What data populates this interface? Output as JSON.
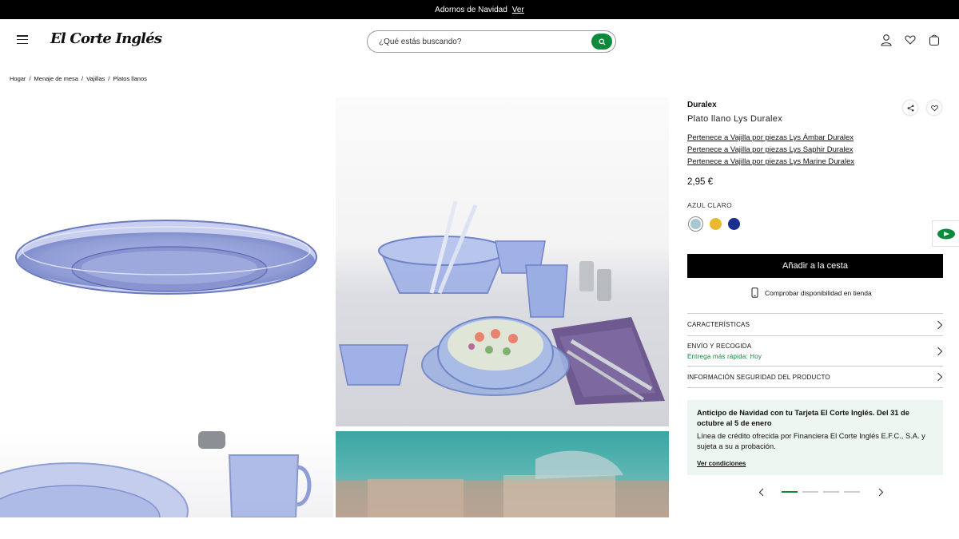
{
  "topbar": {
    "text": "Adornos de Navidad",
    "link": "Ver"
  },
  "header": {
    "logo": "El Corte Inglés",
    "search_placeholder": "¿Qué estás buscando?"
  },
  "breadcrumb": [
    "Hogar",
    "Menaje de mesa",
    "Vajillas",
    "Platos llanos"
  ],
  "product": {
    "brand": "Duralex",
    "name": "Plato llano Lys Duralex",
    "collections": [
      "Pertenece a Vajilla por piezas Lys Ámbar Duralex",
      "Pertenece a Vajilla por piezas Lys Saphir Duralex",
      "Pertenece a Vajilla por piezas Lys Marine Duralex"
    ],
    "price": "2,95 €",
    "color_label": "AZUL CLARO",
    "swatches": [
      {
        "name": "azul-claro",
        "color": "#a9c6d3",
        "selected": true
      },
      {
        "name": "ambar",
        "color": "#e9b92f",
        "selected": false
      },
      {
        "name": "azul-marino",
        "color": "#1b2f8f",
        "selected": false
      }
    ],
    "add_to_cart": "Añadir a la cesta",
    "availability": "Comprobar disponibilidad en tienda"
  },
  "accordion": {
    "features": "CARACTERÍSTICAS",
    "shipping": "ENVÍO Y RECOGIDA",
    "shipping_sub": "Entrega más rápida: Hoy",
    "safety": "INFORMACIÓN SEGURIDAD DEL PRODUCTO"
  },
  "promo": {
    "title": "Anticipo de Navidad con tu Tarjeta El Corte Inglés. Del 31 de octubre al 5 de enero",
    "body": "Línea de crédito ofrecida por Financiera El Corte Inglés E.F.C., S.A. y sujeta a su a probación.",
    "link": "Ver condiciones"
  },
  "carousel": {
    "slides": 4,
    "active": 1
  },
  "colors": {
    "accent": "#0a8a3a",
    "black": "#000000",
    "promo_bg": "#eef6f1"
  }
}
